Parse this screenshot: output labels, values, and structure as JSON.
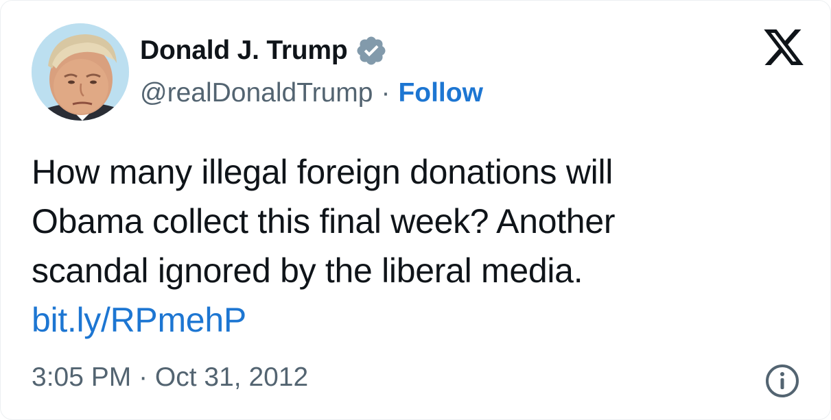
{
  "author": {
    "display_name": "Donald J. Trump",
    "handle": "@realDonaldTrump",
    "separator": "·",
    "follow_label": "Follow",
    "verified_icon": "verified-badge-icon",
    "avatar_icon": "profile-avatar"
  },
  "tweet": {
    "lines": [
      "How many illegal foreign donations will",
      "Obama collect this final week? Another",
      "scandal ignored by the liberal media."
    ],
    "link": "bit.ly/RPmehP"
  },
  "footer": {
    "timestamp": "3:05 PM · Oct 31, 2012",
    "info_icon": "info-icon"
  },
  "branding": {
    "logo_icon": "x-logo-icon"
  },
  "colors": {
    "link_blue": "#1d76d2",
    "secondary_text": "#536471",
    "primary_text": "#0f1419",
    "verified_gray": "#829aab"
  }
}
